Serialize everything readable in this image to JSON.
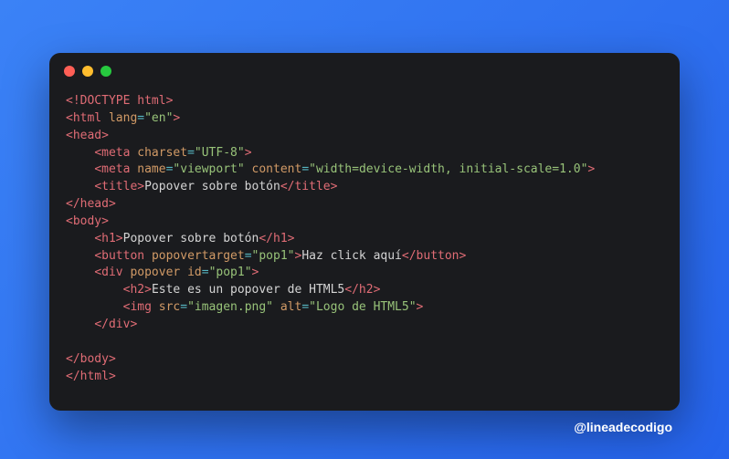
{
  "code": {
    "lines": [
      {
        "indent": 0,
        "tokens": [
          {
            "t": "bracket",
            "v": "<!"
          },
          {
            "t": "doctype",
            "v": "DOCTYPE html"
          },
          {
            "t": "bracket",
            "v": ">"
          }
        ]
      },
      {
        "indent": 0,
        "tokens": [
          {
            "t": "bracket",
            "v": "<"
          },
          {
            "t": "tag",
            "v": "html"
          },
          {
            "t": "text",
            "v": " "
          },
          {
            "t": "attr",
            "v": "lang"
          },
          {
            "t": "eq",
            "v": "="
          },
          {
            "t": "string",
            "v": "\"en\""
          },
          {
            "t": "bracket",
            "v": ">"
          }
        ]
      },
      {
        "indent": 0,
        "tokens": [
          {
            "t": "bracket",
            "v": "<"
          },
          {
            "t": "tag",
            "v": "head"
          },
          {
            "t": "bracket",
            "v": ">"
          }
        ]
      },
      {
        "indent": 1,
        "tokens": [
          {
            "t": "bracket",
            "v": "<"
          },
          {
            "t": "tag",
            "v": "meta"
          },
          {
            "t": "text",
            "v": " "
          },
          {
            "t": "attr",
            "v": "charset"
          },
          {
            "t": "eq",
            "v": "="
          },
          {
            "t": "string",
            "v": "\"UTF-8\""
          },
          {
            "t": "bracket",
            "v": ">"
          }
        ]
      },
      {
        "indent": 1,
        "tokens": [
          {
            "t": "bracket",
            "v": "<"
          },
          {
            "t": "tag",
            "v": "meta"
          },
          {
            "t": "text",
            "v": " "
          },
          {
            "t": "attr",
            "v": "name"
          },
          {
            "t": "eq",
            "v": "="
          },
          {
            "t": "string",
            "v": "\"viewport\""
          },
          {
            "t": "text",
            "v": " "
          },
          {
            "t": "attr",
            "v": "content"
          },
          {
            "t": "eq",
            "v": "="
          },
          {
            "t": "string",
            "v": "\"width=device-width, initial-scale=1.0\""
          },
          {
            "t": "bracket",
            "v": ">"
          }
        ]
      },
      {
        "indent": 1,
        "tokens": [
          {
            "t": "bracket",
            "v": "<"
          },
          {
            "t": "tag",
            "v": "title"
          },
          {
            "t": "bracket",
            "v": ">"
          },
          {
            "t": "text",
            "v": "Popover sobre botón"
          },
          {
            "t": "bracket",
            "v": "</"
          },
          {
            "t": "tag",
            "v": "title"
          },
          {
            "t": "bracket",
            "v": ">"
          }
        ]
      },
      {
        "indent": 0,
        "tokens": [
          {
            "t": "bracket",
            "v": "</"
          },
          {
            "t": "tag",
            "v": "head"
          },
          {
            "t": "bracket",
            "v": ">"
          }
        ]
      },
      {
        "indent": 0,
        "tokens": [
          {
            "t": "bracket",
            "v": "<"
          },
          {
            "t": "tag",
            "v": "body"
          },
          {
            "t": "bracket",
            "v": ">"
          }
        ]
      },
      {
        "indent": 1,
        "tokens": [
          {
            "t": "bracket",
            "v": "<"
          },
          {
            "t": "tag",
            "v": "h1"
          },
          {
            "t": "bracket",
            "v": ">"
          },
          {
            "t": "text",
            "v": "Popover sobre botón"
          },
          {
            "t": "bracket",
            "v": "</"
          },
          {
            "t": "tag",
            "v": "h1"
          },
          {
            "t": "bracket",
            "v": ">"
          }
        ]
      },
      {
        "indent": 1,
        "tokens": [
          {
            "t": "bracket",
            "v": "<"
          },
          {
            "t": "tag",
            "v": "button"
          },
          {
            "t": "text",
            "v": " "
          },
          {
            "t": "attr",
            "v": "popovertarget"
          },
          {
            "t": "eq",
            "v": "="
          },
          {
            "t": "string",
            "v": "\"pop1\""
          },
          {
            "t": "bracket",
            "v": ">"
          },
          {
            "t": "text",
            "v": "Haz click aquí"
          },
          {
            "t": "bracket",
            "v": "</"
          },
          {
            "t": "tag",
            "v": "button"
          },
          {
            "t": "bracket",
            "v": ">"
          }
        ]
      },
      {
        "indent": 1,
        "tokens": [
          {
            "t": "bracket",
            "v": "<"
          },
          {
            "t": "tag",
            "v": "div"
          },
          {
            "t": "text",
            "v": " "
          },
          {
            "t": "attr",
            "v": "popover"
          },
          {
            "t": "text",
            "v": " "
          },
          {
            "t": "attr",
            "v": "id"
          },
          {
            "t": "eq",
            "v": "="
          },
          {
            "t": "string",
            "v": "\"pop1\""
          },
          {
            "t": "bracket",
            "v": ">"
          }
        ]
      },
      {
        "indent": 2,
        "tokens": [
          {
            "t": "bracket",
            "v": "<"
          },
          {
            "t": "tag",
            "v": "h2"
          },
          {
            "t": "bracket",
            "v": ">"
          },
          {
            "t": "text",
            "v": "Este es un popover de HTML5"
          },
          {
            "t": "bracket",
            "v": "</"
          },
          {
            "t": "tag",
            "v": "h2"
          },
          {
            "t": "bracket",
            "v": ">"
          }
        ]
      },
      {
        "indent": 2,
        "tokens": [
          {
            "t": "bracket",
            "v": "<"
          },
          {
            "t": "tag",
            "v": "img"
          },
          {
            "t": "text",
            "v": " "
          },
          {
            "t": "attr",
            "v": "src"
          },
          {
            "t": "eq",
            "v": "="
          },
          {
            "t": "string",
            "v": "\"imagen.png\""
          },
          {
            "t": "text",
            "v": " "
          },
          {
            "t": "attr",
            "v": "alt"
          },
          {
            "t": "eq",
            "v": "="
          },
          {
            "t": "string",
            "v": "\"Logo de HTML5\""
          },
          {
            "t": "bracket",
            "v": ">"
          }
        ]
      },
      {
        "indent": 1,
        "tokens": [
          {
            "t": "bracket",
            "v": "</"
          },
          {
            "t": "tag",
            "v": "div"
          },
          {
            "t": "bracket",
            "v": ">"
          }
        ]
      },
      {
        "indent": 0,
        "tokens": []
      },
      {
        "indent": 0,
        "tokens": [
          {
            "t": "bracket",
            "v": "</"
          },
          {
            "t": "tag",
            "v": "body"
          },
          {
            "t": "bracket",
            "v": ">"
          }
        ]
      },
      {
        "indent": 0,
        "tokens": [
          {
            "t": "bracket",
            "v": "</"
          },
          {
            "t": "tag",
            "v": "html"
          },
          {
            "t": "bracket",
            "v": ">"
          }
        ]
      }
    ]
  },
  "footer": {
    "attribution": "@lineadecodigo"
  },
  "colors": {
    "background_gradient_start": "#3b82f6",
    "background_gradient_end": "#2563eb",
    "window_bg": "#1a1b1e",
    "bracket": "#abb2bf",
    "tag": "#e06c75",
    "attr": "#d19a66",
    "eq": "#56b6c2",
    "string": "#98c379",
    "text": "#d4d4d4",
    "red": "#ff5f56",
    "yellow": "#ffbd2e",
    "green": "#27c93f"
  }
}
